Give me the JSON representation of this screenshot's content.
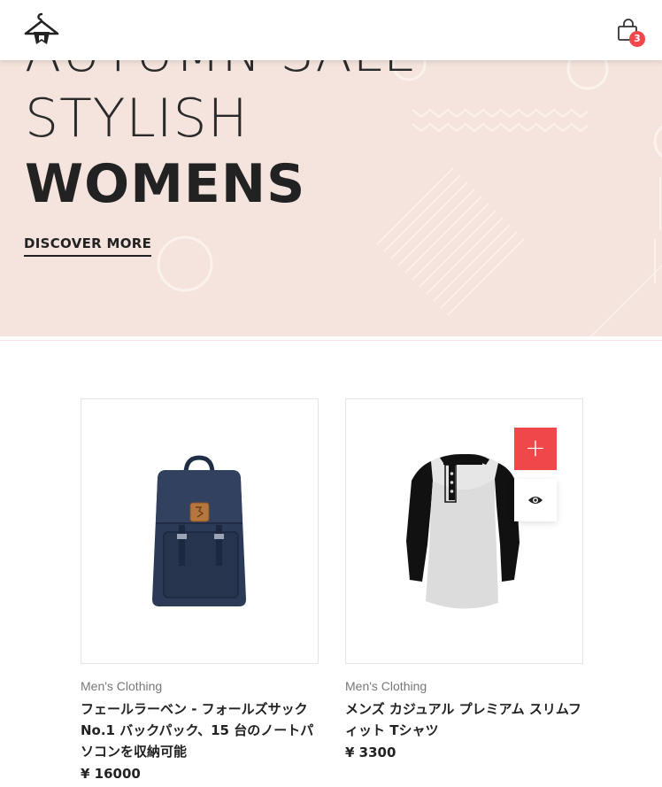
{
  "header": {
    "logo_icon": "hanger-logo-icon",
    "cart_icon": "shopping-bag-icon",
    "cart_count": "3"
  },
  "hero": {
    "line1": "AUTUMN SALE",
    "line2": "STYLISH",
    "line3": "WOMENS",
    "cta": "DISCOVER MORE",
    "background": "#f4e4dd"
  },
  "products": [
    {
      "category": "Men's Clothing",
      "title": "フェールラーベン - フォールズサック No.1 バックパック、15 台のノートパソコンを収納可能",
      "price": "¥ 16000",
      "image_icon": "backpack-image"
    },
    {
      "category": "Men's Clothing",
      "title": "メンズ カジュアル プレミアム スリムフィット Tシャツ",
      "price": "¥ 3300",
      "image_icon": "raglan-shirt-image",
      "add_icon": "plus-icon",
      "view_icon": "eye-icon"
    }
  ],
  "colors": {
    "accent": "#f0474a",
    "text": "#222222"
  }
}
